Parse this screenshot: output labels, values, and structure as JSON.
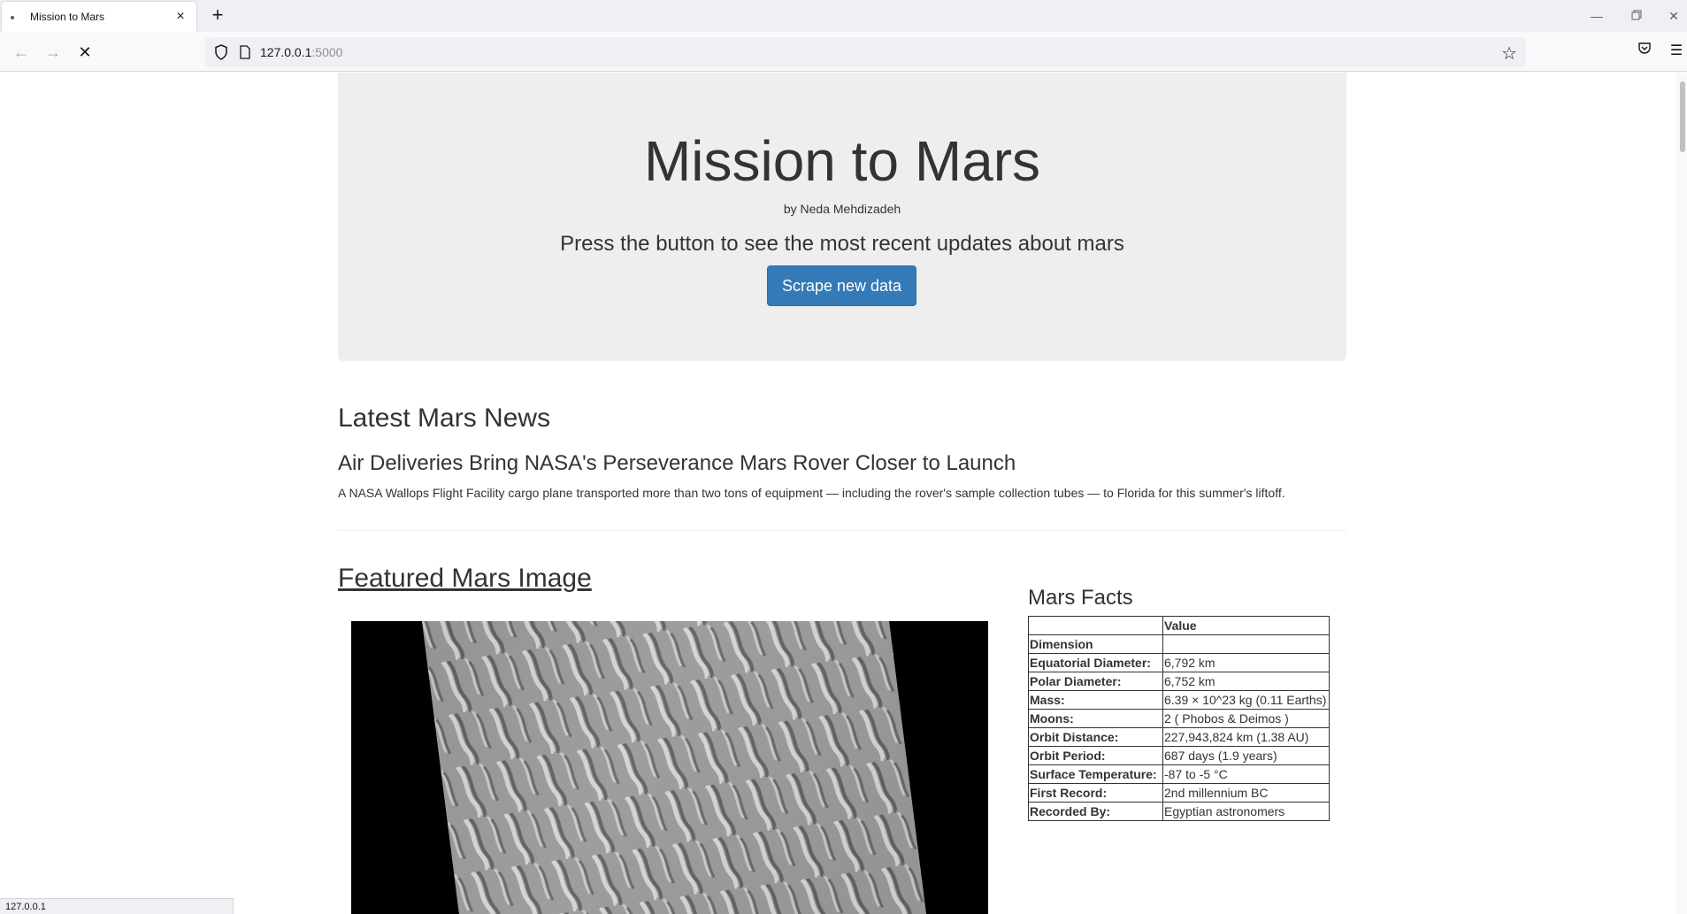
{
  "browser": {
    "tab_title": "Mission to Mars",
    "tab_close": "×",
    "new_tab": "+",
    "url_host": "127.0.0.1",
    "url_port": ":5000",
    "status_text": "127.0.0.1"
  },
  "jumbotron": {
    "title": "Mission to Mars",
    "author": "by Neda Mehdizadeh",
    "subtitle": "Press the button to see the most recent updates about mars",
    "button_label": "Scrape new data",
    "button_color": "#337ab7"
  },
  "news": {
    "heading": "Latest Mars News",
    "title": "Air Deliveries Bring NASA's Perseverance Mars Rover Closer to Launch",
    "paragraph": "A NASA Wallops Flight Facility cargo plane transported more than two tons of equipment — including the rover's sample collection tubes — to Florida for this summer's liftoff."
  },
  "featured": {
    "heading": "Featured Mars Image"
  },
  "facts": {
    "heading": "Mars Facts",
    "columns": [
      "",
      "Value"
    ],
    "rows": [
      {
        "key": "Dimension",
        "value": ""
      },
      {
        "key": "Equatorial Diameter:",
        "value": "6,792 km"
      },
      {
        "key": "Polar Diameter:",
        "value": "6,752 km"
      },
      {
        "key": "Mass:",
        "value": "6.39 × 10^23 kg (0.11 Earths)"
      },
      {
        "key": "Moons:",
        "value": "2 ( Phobos & Deimos )"
      },
      {
        "key": "Orbit Distance:",
        "value": "227,943,824 km (1.38 AU)"
      },
      {
        "key": "Orbit Period:",
        "value": "687 days (1.9 years)"
      },
      {
        "key": "Surface Temperature:",
        "value": "-87 to -5 °C"
      },
      {
        "key": "First Record:",
        "value": "2nd millennium BC"
      },
      {
        "key": "Recorded By:",
        "value": "Egyptian astronomers"
      }
    ]
  }
}
